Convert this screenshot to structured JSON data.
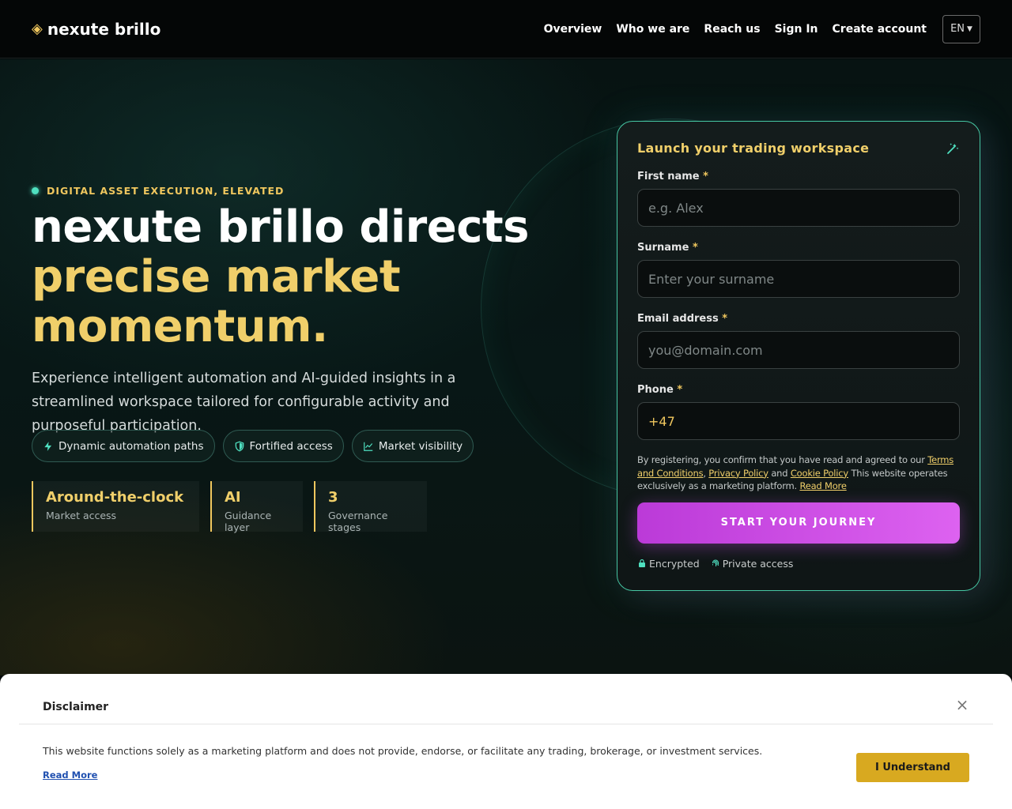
{
  "header": {
    "brand": "nexute brillo",
    "nav": [
      "Overview",
      "Who we are",
      "Reach us",
      "Sign In",
      "Create account"
    ],
    "language": "EN"
  },
  "hero": {
    "eyebrow": "DIGITAL ASSET EXECUTION, ELEVATED",
    "headline_line1": "nexute brillo directs",
    "headline_line2": "precise market",
    "headline_line3": "momentum.",
    "lead": "Experience intelligent automation and AI-guided insights in a streamlined workspace tailored for configurable activity and purposeful participation.",
    "pills": [
      "Dynamic automation paths",
      "Fortified access",
      "Market visibility"
    ],
    "stats": [
      {
        "value": "Around-the-clock",
        "label": "Market access"
      },
      {
        "value": "AI",
        "label": "Guidance layer"
      },
      {
        "value": "3",
        "label": "Governance stages"
      }
    ]
  },
  "form": {
    "title": "Launch your trading workspace",
    "fields": [
      {
        "label": "First name",
        "required": "*",
        "placeholder": "e.g. Alex",
        "value": ""
      },
      {
        "label": "Surname",
        "required": "*",
        "placeholder": "Enter your surname",
        "value": ""
      },
      {
        "label": "Email address",
        "required": "*",
        "placeholder": "you@domain.com",
        "value": ""
      },
      {
        "label": "Phone",
        "required": "*",
        "placeholder": "",
        "value": "+47"
      }
    ],
    "legal": {
      "prefix": "By registering, you confirm that you have read and agreed to our ",
      "terms": "Terms and Conditions",
      "comma": ", ",
      "privacy": "Privacy Policy",
      "and": " and ",
      "cookie": "Cookie Policy",
      "suffix": " This website operates exclusively as a marketing platform. ",
      "read_more": "Read More"
    },
    "cta": "START YOUR JOURNEY",
    "trust": [
      "Encrypted",
      "Private access"
    ]
  },
  "disclaimer": {
    "title": "Disclaimer",
    "text": "This website functions solely as a marketing platform and does not provide, endorse, or facilitate any trading, brokerage, or investment services.",
    "read_more": "Read More",
    "button": "I Understand"
  },
  "colors": {
    "accent_gold": "#f0c75e",
    "accent_teal": "#4fe0c0",
    "cta_purple": "#d050ea",
    "disclaimer_button": "#d8a920"
  }
}
